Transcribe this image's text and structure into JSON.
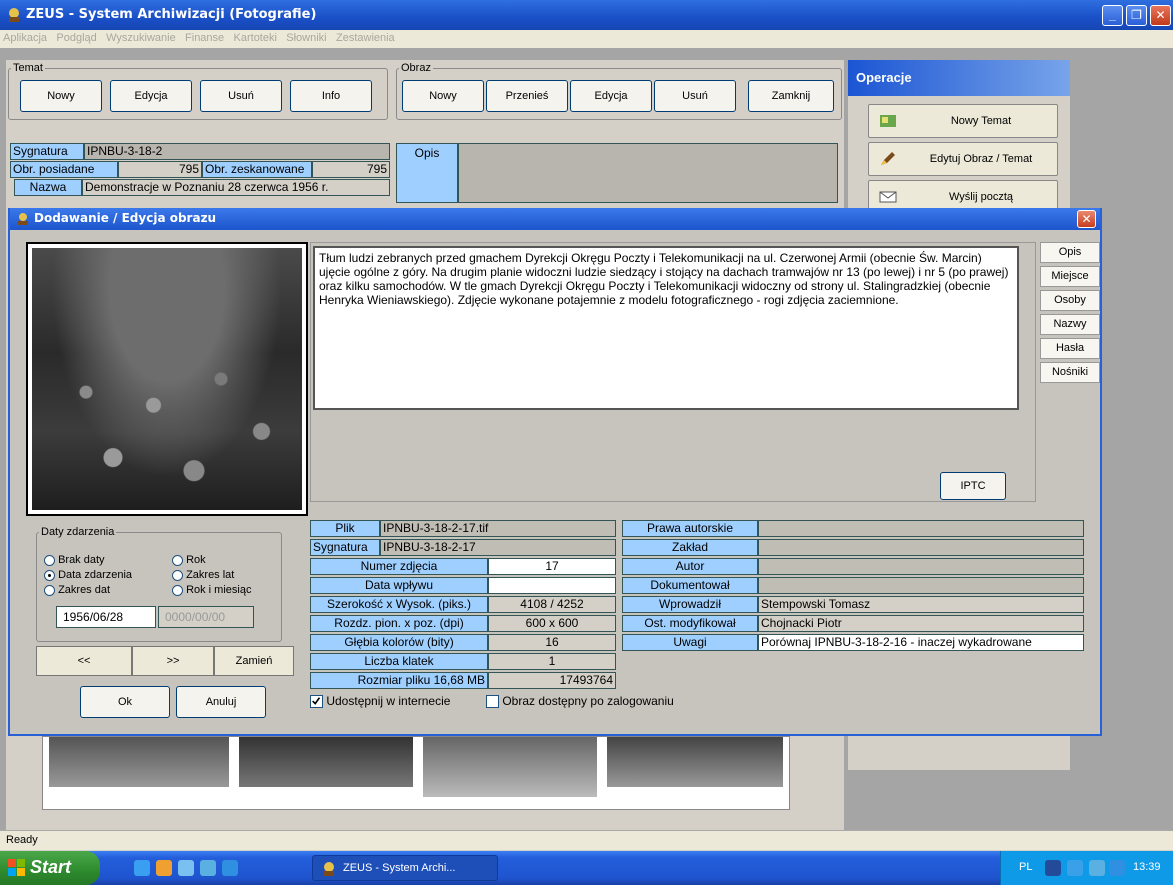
{
  "window": {
    "title": "ZEUS - System Archiwizacji  (Fotografie)",
    "min": "_",
    "max": "❐",
    "close": "✕"
  },
  "menu": [
    "Aplikacja",
    "Podgląd",
    "Wyszukiwanie",
    "Finanse",
    "Kartoteki",
    "Słowniki",
    "Zestawienia"
  ],
  "temat": {
    "legend": "Temat",
    "buttons": [
      "Nowy",
      "Edycja",
      "Usuń",
      "Info"
    ]
  },
  "obraz": {
    "legend": "Obraz",
    "buttons": [
      "Nowy",
      "Przenieś",
      "Edycja",
      "Usuń"
    ],
    "close": "Zamknij"
  },
  "record": {
    "sygnatura_label": "Sygnatura",
    "sygnatura": "IPNBU-3-18-2",
    "obr_posiadane_label": "Obr. posiadane",
    "obr_posiadane": "795",
    "obr_zeskanowane_label": "Obr. zeskanowane",
    "obr_zeskanowane": "795",
    "nazwa_label": "Nazwa",
    "nazwa": "Demonstracje w Poznaniu 28 czerwca 1956 r.",
    "opis_label": "Opis"
  },
  "operacje": {
    "header": "Operacje",
    "buttons": [
      "Nowy Temat",
      "Edytuj Obraz / Temat",
      "Wyślij pocztą"
    ]
  },
  "dialog": {
    "title": "Dodawanie / Edycja obrazu",
    "close": "✕",
    "description": "Tłum ludzi zebranych przed gmachem  Dyrekcji Okręgu Poczty i Telekomunikacji na ul. Czerwonej Armii (obecnie Św. Marcin) ujęcie ogólne z góry. Na drugim planie widoczni ludzie siedzący i stojący na dachach tramwajów nr 13 (po lewej) i nr 5 (po prawej) oraz kilku samochodów. W tle gmach Dyrekcji Okręgu Poczty i Telekomunikacji widoczny od strony ul. Stalingradzkiej (obecnie Henryka Wieniawskiego). Zdjęcie wykonane potajemnie z modelu fotograficznego - rogi zdjęcia zaciemnione.",
    "tabs": [
      "Opis",
      "Miejsce",
      "Osoby",
      "Nazwy",
      "Hasła",
      "Nośniki"
    ],
    "iptc": "IPTC",
    "daty": {
      "legend": "Daty zdarzenia",
      "options": [
        "Brak daty",
        "Rok",
        "Data zdarzenia",
        "Zakres lat",
        "Zakres dat",
        "Rok i miesiąc"
      ],
      "selected": "Data zdarzenia",
      "date_value": "1956/06/28",
      "date_placeholder": "0000/00/00"
    },
    "nav": {
      "prev": "<<",
      "next": ">>",
      "swap": "Zamień"
    },
    "ok": "Ok",
    "cancel": "Anuluj",
    "fields_left": [
      {
        "label": "Plik",
        "value": "IPNBU-3-18-2-17.tif"
      },
      {
        "label": "Sygnatura",
        "value": "IPNBU-3-18-2-17"
      },
      {
        "label": "Numer zdjęcia",
        "value": "17"
      },
      {
        "label": "Data wpływu",
        "value": ""
      },
      {
        "label": "Szerokość x Wysok. (piks.)",
        "value": "4108 / 4252"
      },
      {
        "label": "Rozdz. pion. x poz. (dpi)",
        "value": "600 x 600"
      },
      {
        "label": "Głębia kolorów (bity)",
        "value": "16"
      },
      {
        "label": "Liczba klatek",
        "value": "1"
      },
      {
        "label": "Rozmiar pliku 16,68 MB",
        "value": "17493764"
      }
    ],
    "fields_right": [
      {
        "label": "Prawa autorskie",
        "value": ""
      },
      {
        "label": "Zakład",
        "value": ""
      },
      {
        "label": "Autor",
        "value": ""
      },
      {
        "label": "Dokumentował",
        "value": ""
      },
      {
        "label": "Wprowadził",
        "value": "Stempowski Tomasz"
      },
      {
        "label": "Ost. modyfikował",
        "value": "Chojnacki Piotr"
      },
      {
        "label": "Uwagi",
        "value": "Porównaj IPNBU-3-18-2-16 -  inaczej wykadrowane"
      }
    ],
    "share_internet": "Udostępnij w internecie",
    "share_internet_checked": true,
    "login_only": "Obraz dostępny po zalogowaniu",
    "login_only_checked": false
  },
  "status": "Ready",
  "taskbar": {
    "start": "Start",
    "task": "ZEUS - System Archi...",
    "lang": "PL",
    "time": "13:39"
  }
}
